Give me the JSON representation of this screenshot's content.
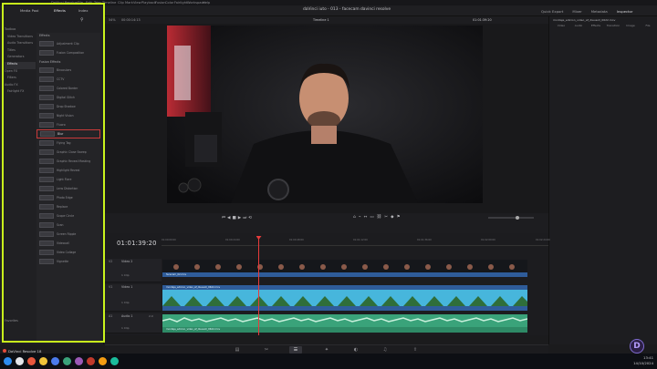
{
  "menubar": {
    "items": [
      "DaVinci Resolve",
      "File",
      "Edit",
      "Trim",
      "Timeline",
      "Clip",
      "Mark",
      "View",
      "Playback",
      "Fusion",
      "Color",
      "Fairlight",
      "Workspace",
      "Help"
    ]
  },
  "window": {
    "title": "daVinci iuto - 013 - facecam davinci resolve"
  },
  "effects_panel": {
    "toolbar": {
      "media_pool": "Media Pool",
      "effects": "Effects",
      "edit_index": "Index",
      "sound_library": "Sound Library"
    },
    "categories": [
      "Toolbox",
      "Video Transitions",
      "Audio Transitions",
      "Titles",
      "Generators",
      "Effects",
      "Open FX",
      "Filters",
      "Audio FX",
      "Fairlight FX",
      "Favorites"
    ],
    "selected_category": "Effects",
    "groups": [
      "Effects",
      "Fusion Effects"
    ],
    "effects_items": [
      "Adjustment Clip",
      "Fusion Composition"
    ],
    "fusion_items": [
      "Binoculars",
      "CCTV",
      "Colored Border",
      "Digital Glitch",
      "Drop Shadow",
      "Night Vision",
      "Fluoro",
      "Blur",
      "Flying Tag",
      "Graphic Close Sweep",
      "Graphic Reveal Masking",
      "Highlight Reveal",
      "Light Flare",
      "Lens Distortion",
      "Photo Edge",
      "Replace",
      "Scope Circle",
      "Scan",
      "Screen Ripple",
      "Videocall",
      "Video Collage",
      "Vignette"
    ],
    "selected_item": "Blur"
  },
  "viewer": {
    "zoom": "54%",
    "timecode_left": "00:00:14:13",
    "timeline_name": "Timeline 1",
    "timecode_right": "01:01:39:20"
  },
  "inspector": {
    "title": "Inspector",
    "tabs": [
      "Video",
      "Audio",
      "Effects",
      "Transition",
      "Image",
      "File"
    ],
    "clip_name": "montaje_edicion_video_af_dieusoll_0622.mov"
  },
  "header_tools": [
    "Quick Export",
    "Mixer",
    "Metadata",
    "Inspector"
  ],
  "timeline": {
    "timecode": "01:01:39:20",
    "ruler": [
      "01:00:00:00",
      "01:00:24:00",
      "01:00:48:00",
      "01:01:12:00",
      "01:01:36:00",
      "01:02:00:00",
      "01:02:24:00"
    ],
    "tracks": [
      {
        "id": "V2",
        "name": "Video 2",
        "clips": "1 Clip",
        "clip_name": "facecam_02.mov"
      },
      {
        "id": "V1",
        "name": "Video 1",
        "clips": "1 Clip",
        "clip_name": "montaje_edicion_video_af_dieusoll_0622.mov"
      },
      {
        "id": "A1",
        "name": "Audio 1",
        "clips": "1 Clip",
        "clip_name": "montaje_edicion_video_af_dieusoll_0622.mov",
        "volume": "2.0"
      }
    ]
  },
  "pagebar": {
    "pages": [
      "Media",
      "Cut",
      "Edit",
      "Fusion",
      "Color",
      "Fairlight",
      "Deliver"
    ],
    "active": "Edit"
  },
  "taskbar": {
    "app_label": "DaVinci Resolve 18",
    "time": "13:41",
    "date": "14/10/2024"
  },
  "colors": {
    "highlight": "#c9f31c",
    "audio_clip": "#3aa37a",
    "video_clip": "#2f5c9a",
    "playhead": "#e83b3b"
  }
}
